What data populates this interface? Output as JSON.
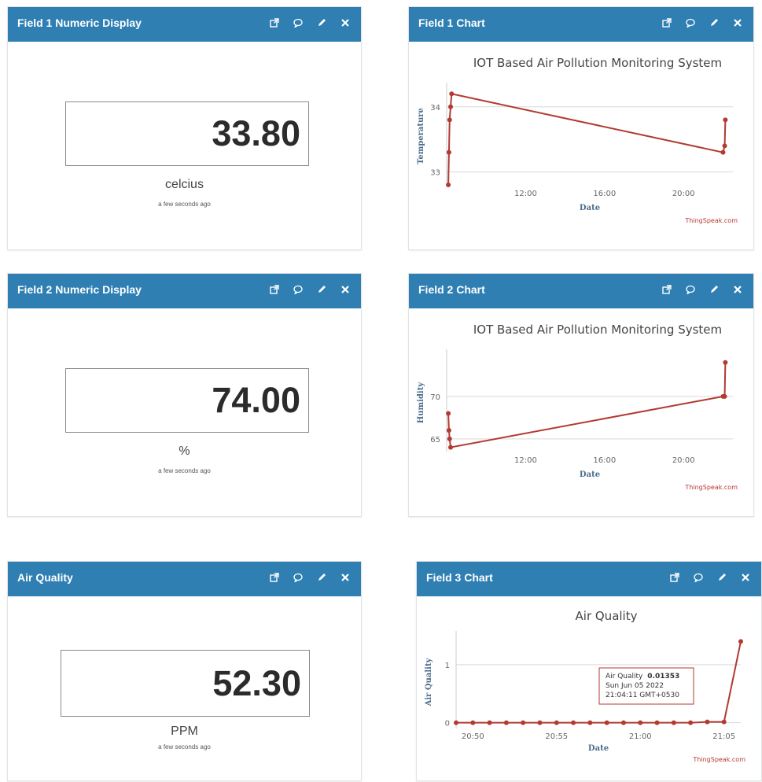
{
  "colors": {
    "header": "#2f7fb3",
    "line": "#b23a33",
    "grid": "#d9d9d9"
  },
  "header_icons": [
    "external-link-icon",
    "comment-icon",
    "pencil-icon",
    "close-icon"
  ],
  "widgets": {
    "field1_display": {
      "title": "Field 1 Numeric Display",
      "value": "33.80",
      "unit": "celcius",
      "updated": "a few seconds ago"
    },
    "field2_display": {
      "title": "Field 2 Numeric Display",
      "value": "74.00",
      "unit": "%",
      "updated": "a few seconds ago"
    },
    "air_quality_display": {
      "title": "Air Quality",
      "value": "52.30",
      "unit": "PPM",
      "updated": "a few seconds ago"
    },
    "field1_chart": {
      "title": "Field 1 Chart",
      "credit": "ThingSpeak.com"
    },
    "field2_chart": {
      "title": "Field 2 Chart",
      "credit": "ThingSpeak.com"
    },
    "field3_chart": {
      "title": "Field 3 Chart",
      "credit": "ThingSpeak.com",
      "tooltip": {
        "label": "Air Quality",
        "value": "0.01353",
        "date": "Sun Jun 05 2022",
        "time": "21:04:11 GMT+0530"
      }
    }
  },
  "chart_data": [
    {
      "type": "line",
      "title": "IOT Based Air Pollution Monitoring System",
      "xlabel": "Date",
      "ylabel": "Temperature",
      "x_ticks": [
        "12:00",
        "16:00",
        "20:00"
      ],
      "y_ticks": [
        "33",
        "34"
      ],
      "xlim": [
        "08:00",
        "22:30"
      ],
      "ylim": [
        32.8,
        34.3
      ],
      "grid": true,
      "series": [
        {
          "x": [
            "08:05",
            "08:07",
            "08:09",
            "08:12",
            "08:15",
            "22:00",
            "22:05",
            "22:07"
          ],
          "y": [
            32.8,
            33.3,
            33.8,
            34.0,
            34.2,
            33.3,
            33.4,
            33.8
          ]
        }
      ]
    },
    {
      "type": "line",
      "title": "IOT Based Air Pollution Monitoring System",
      "xlabel": "Date",
      "ylabel": "Humidity",
      "x_ticks": [
        "12:00",
        "16:00",
        "20:00"
      ],
      "y_ticks": [
        "65",
        "70"
      ],
      "xlim": [
        "08:00",
        "22:30"
      ],
      "ylim": [
        63.5,
        75
      ],
      "grid": true,
      "series": [
        {
          "x": [
            "08:05",
            "08:07",
            "08:09",
            "08:12",
            "22:00",
            "22:05",
            "22:07"
          ],
          "y": [
            68.0,
            66.0,
            65.0,
            64.0,
            70.0,
            70.0,
            74.0
          ]
        }
      ]
    },
    {
      "type": "line",
      "title": "Air Quality",
      "xlabel": "Date",
      "ylabel": "Air Quality",
      "x_ticks": [
        "20:50",
        "20:55",
        "21:00",
        "21:05"
      ],
      "y_ticks": [
        "0",
        "1"
      ],
      "xlim": [
        "20:49",
        "21:06"
      ],
      "ylim": [
        -0.1,
        1.5
      ],
      "grid": true,
      "series": [
        {
          "x": [
            "20:49",
            "20:50",
            "20:51",
            "20:52",
            "20:53",
            "20:54",
            "20:55",
            "20:56",
            "20:57",
            "20:58",
            "20:59",
            "21:00",
            "21:01",
            "21:02",
            "21:03",
            "21:04",
            "21:05",
            "21:06"
          ],
          "y": [
            0,
            0,
            0,
            0,
            0,
            0,
            0,
            0,
            0,
            0,
            0,
            0,
            0,
            0,
            0,
            0.01353,
            0.01353,
            1.4
          ]
        }
      ]
    }
  ]
}
